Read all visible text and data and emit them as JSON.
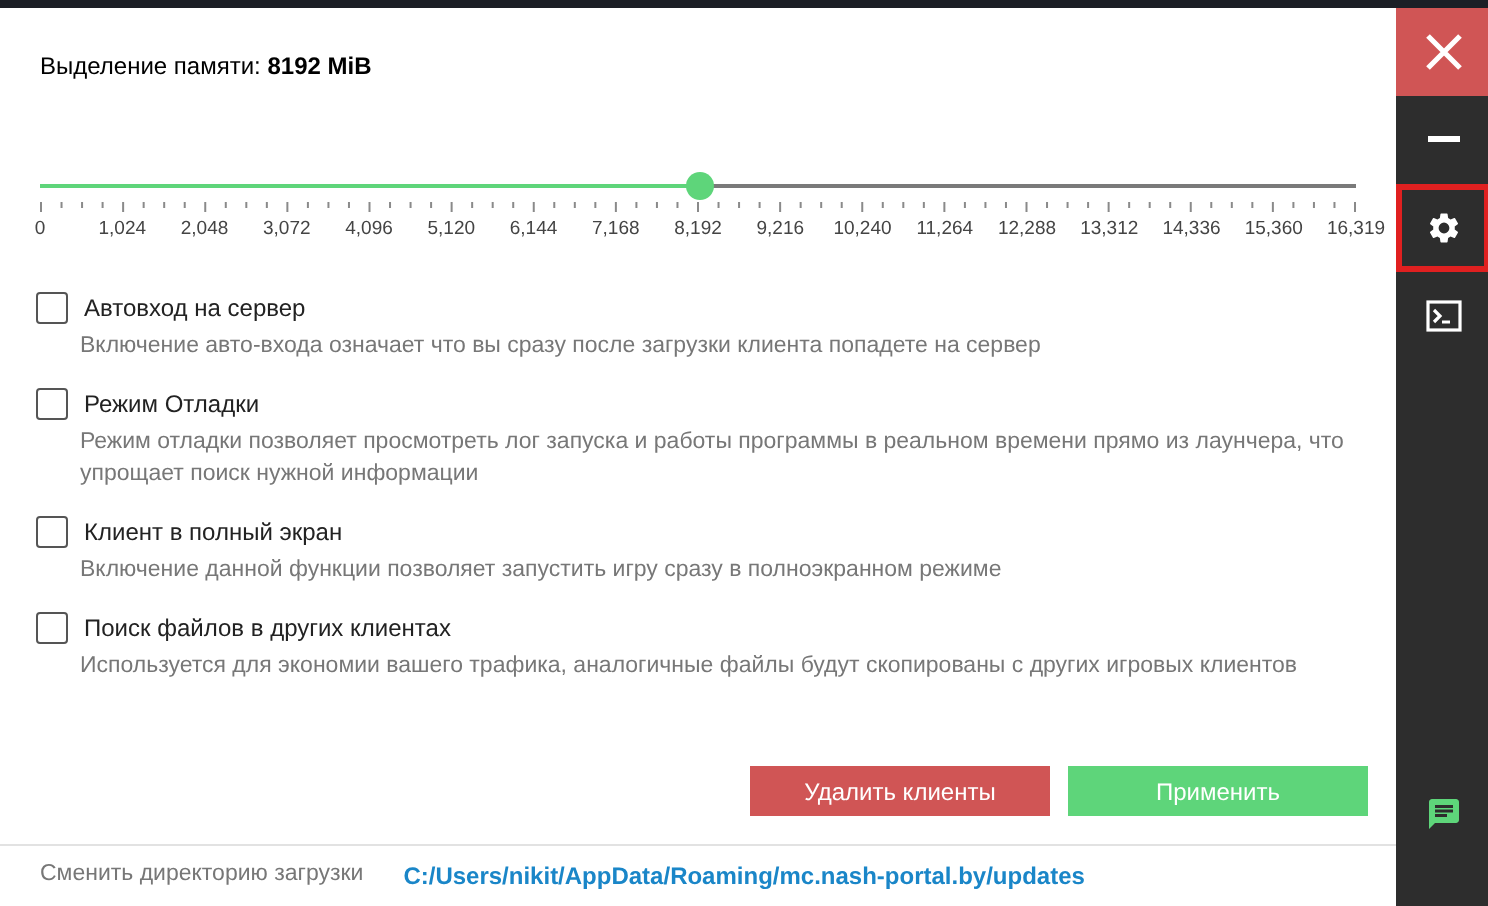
{
  "memory": {
    "label": "Выделение памяти: **8192 MiB**",
    "level": 0.502,
    "ticks": [
      "0",
      "1,024",
      "2,048",
      "3,072",
      "4,096",
      "5,120",
      "6,144",
      "7,168",
      "8,192",
      "9,216",
      "10,240",
      "11,264",
      "12,288",
      "13,312",
      "14,336",
      "15,360",
      "16,319"
    ]
  },
  "options": [
    {
      "title": "Автовход на сервер",
      "description": "Включение авто-входа означает что вы сразу после загрузки клиента попадете на сервер",
      "checked": false
    },
    {
      "title": "Режим Отладки",
      "description": "Режим отладки позволяет просмотреть лог запуска и работы программы в реальном времени прямо из лаунчера, что упрощает поиск нужной информации",
      "checked": false
    },
    {
      "title": "Клиент в полный экран",
      "description": "Включение данной функции позволяет запустить игру сразу в полноэкранном режиме",
      "checked": false
    },
    {
      "title": "Поиск файлов в других клиентах",
      "description": "Используется для экономии вашего трафика, аналогичные файлы будут скопированы с других игровых клиентов",
      "checked": false
    }
  ],
  "buttons": [
    {
      "label": "Удалить клиенты",
      "kind": "danger"
    },
    {
      "label": "Применить",
      "kind": "primary"
    }
  ],
  "footer": {
    "label": "Сменить директорию загрузки",
    "path": "C:/Users/nikit/AppData/Roaming/mc.nash-portal.by/updates"
  },
  "sidebar": {
    "items": [
      {
        "kind": "close",
        "selected": false
      },
      {
        "kind": "minimize",
        "selected": false
      },
      {
        "kind": "settings",
        "selected": true
      },
      {
        "kind": "console",
        "selected": false
      }
    ],
    "bottom": {
      "kind": "chat"
    }
  }
}
